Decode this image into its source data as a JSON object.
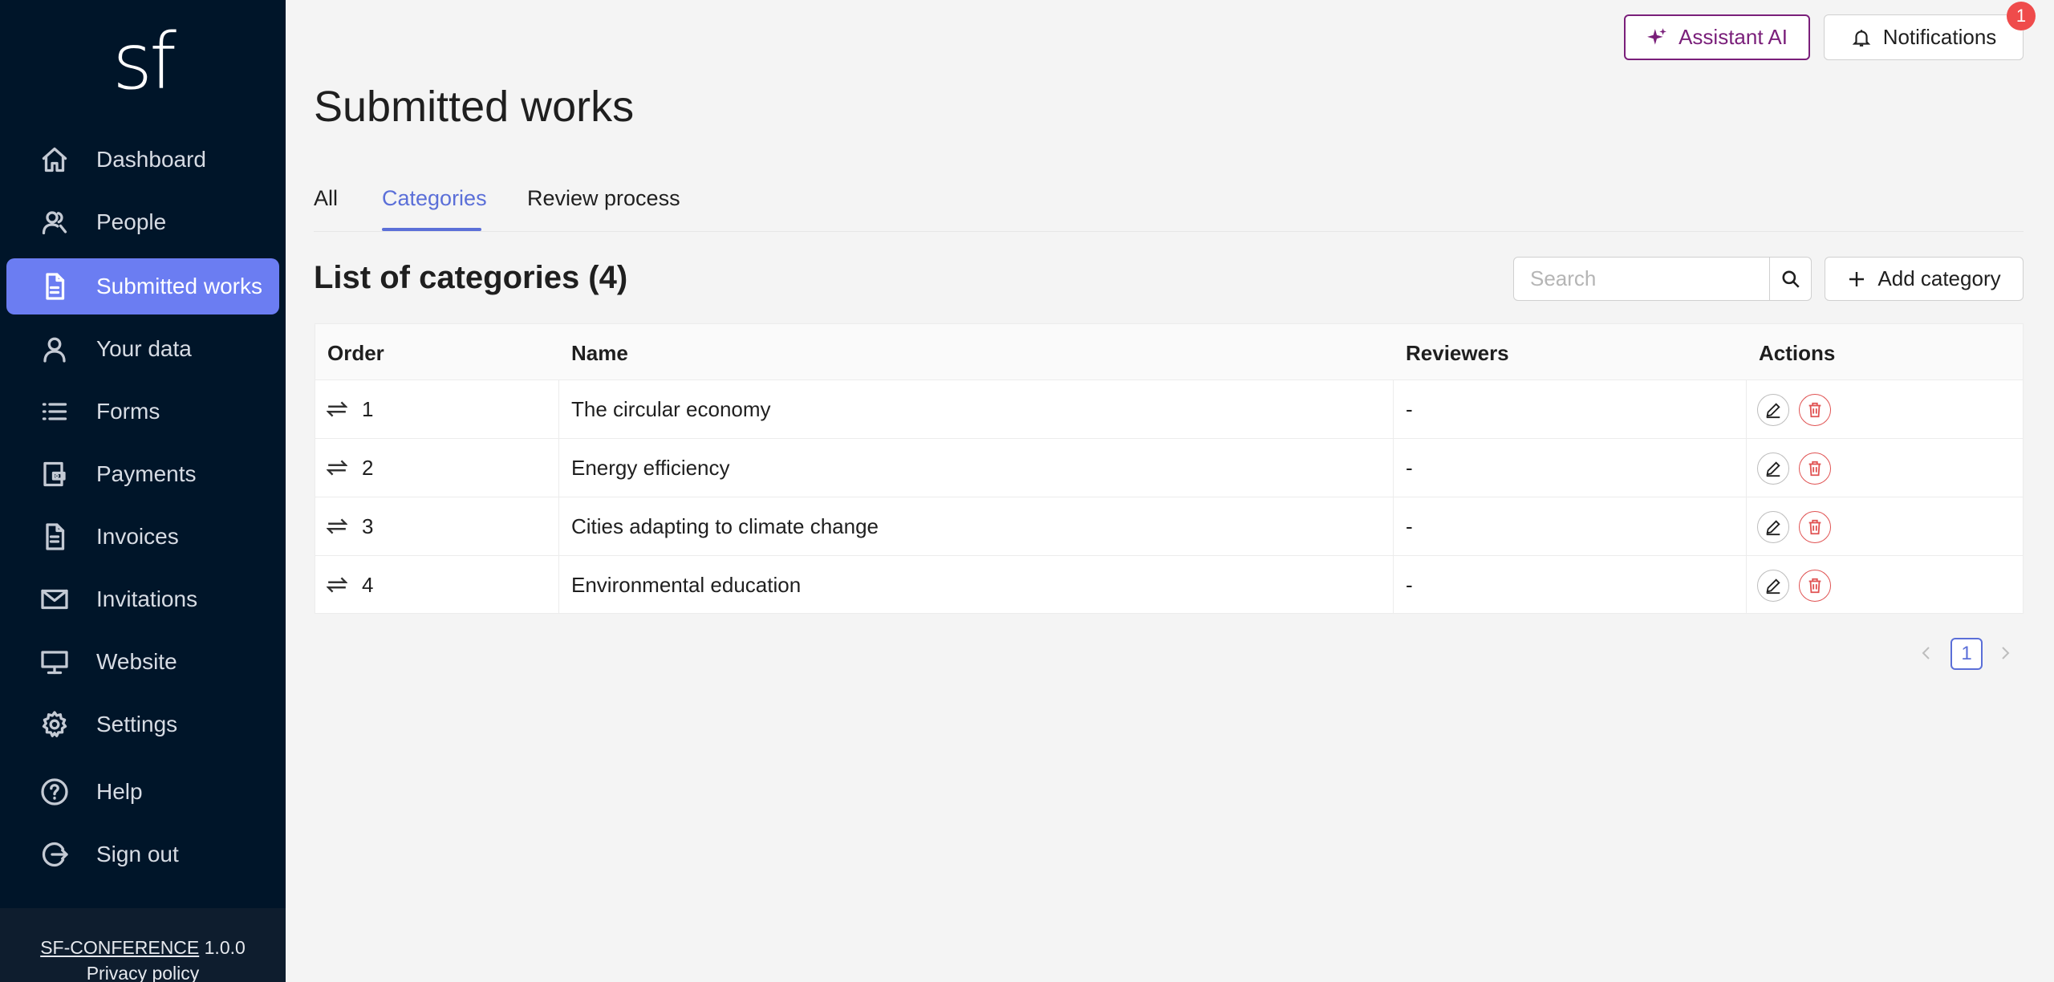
{
  "app": {
    "logo_text": "sf",
    "footer_brand": "SF-CONFERENCE",
    "footer_version": "1.0.0",
    "footer_privacy": "Privacy policy"
  },
  "sidebar": {
    "items": [
      {
        "label": "Dashboard",
        "icon": "home-icon",
        "active": false
      },
      {
        "label": "People",
        "icon": "people-icon",
        "active": false
      },
      {
        "label": "Submitted works",
        "icon": "document-icon",
        "active": true
      },
      {
        "label": "Your data",
        "icon": "user-icon",
        "active": false
      },
      {
        "label": "Forms",
        "icon": "list-icon",
        "active": false
      },
      {
        "label": "Payments",
        "icon": "wallet-icon",
        "active": false
      },
      {
        "label": "Invoices",
        "icon": "invoice-icon",
        "active": false
      },
      {
        "label": "Invitations",
        "icon": "mail-icon",
        "active": false
      },
      {
        "label": "Website",
        "icon": "monitor-icon",
        "active": false
      },
      {
        "label": "Settings",
        "icon": "gear-icon",
        "active": false
      },
      {
        "label": "Help",
        "icon": "help-icon",
        "active": false
      },
      {
        "label": "Sign out",
        "icon": "sign-out-icon",
        "active": false
      }
    ]
  },
  "header": {
    "assistant_label": "Assistant AI",
    "notifications_label": "Notifications",
    "notifications_count": "1"
  },
  "page": {
    "title": "Submitted works",
    "tabs": [
      {
        "label": "All",
        "active": false
      },
      {
        "label": "Categories",
        "active": true
      },
      {
        "label": "Review process",
        "active": false
      }
    ],
    "list_title": "List of categories (4)",
    "search_placeholder": "Search",
    "add_label": "Add category"
  },
  "table": {
    "columns": [
      "Order",
      "Name",
      "Reviewers",
      "Actions"
    ],
    "rows": [
      {
        "order": "1",
        "name": "The circular economy",
        "reviewers": "-"
      },
      {
        "order": "2",
        "name": "Energy efficiency",
        "reviewers": "-"
      },
      {
        "order": "3",
        "name": "Cities adapting to climate change",
        "reviewers": "-"
      },
      {
        "order": "4",
        "name": "Environmental education",
        "reviewers": "-"
      }
    ]
  },
  "pagination": {
    "current_page": "1"
  },
  "colors": {
    "sidebar_bg": "#001529",
    "active_nav": "#6b7df2",
    "accent": "#5b6fd8",
    "assistant": "#7a1f7a",
    "danger": "#e05252",
    "badge": "#ef4b4b"
  }
}
